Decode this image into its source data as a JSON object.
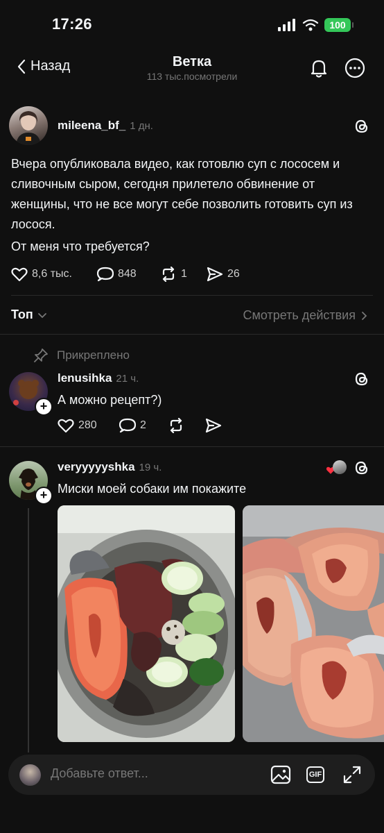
{
  "status_bar": {
    "time": "17:26",
    "battery": "100"
  },
  "header": {
    "back_label": "Назад",
    "title": "Ветка",
    "subtitle": "113 тыс.посмотрели"
  },
  "post": {
    "username": "mileena_bf_",
    "time": "1 дн.",
    "paragraph1": "Вчера опубликовала видео, как готовлю суп с лососем и сливочным сыром, сегодня прилетело обвинение от женщины, что не все могут себе позволить готовить суп из лосося.",
    "paragraph2": "От меня что требуется?",
    "likes": "8,6 тыс.",
    "comments": "848",
    "reposts": "1",
    "shares": "26"
  },
  "sort": {
    "label": "Топ",
    "activity_link": "Смотреть действия"
  },
  "pinned_label": "Прикреплено",
  "replies": [
    {
      "username": "lenusihka",
      "time": "21 ч.",
      "text": "А можно рецепт?)",
      "likes": "280",
      "comments": "2"
    },
    {
      "username": "veryyyyyshka",
      "time": "19 ч.",
      "text": "Миски моей собаки им покажите"
    }
  ],
  "composer": {
    "placeholder": "Добавьте ответ...",
    "gif_label": "GIF"
  },
  "colors": {
    "background": "#101010",
    "text": "#f3f5f7",
    "muted": "#777777",
    "battery": "#34c759"
  }
}
